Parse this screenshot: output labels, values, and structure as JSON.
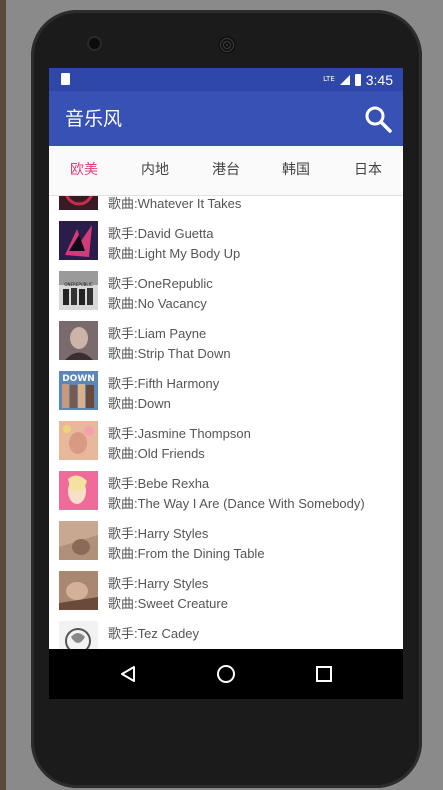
{
  "status_bar": {
    "network_label": "LTE",
    "time": "3:45"
  },
  "app_bar": {
    "title": "音乐风"
  },
  "tabs": [
    {
      "label": "欧美",
      "active": true
    },
    {
      "label": "内地",
      "active": false
    },
    {
      "label": "港台",
      "active": false
    },
    {
      "label": "韩国",
      "active": false
    },
    {
      "label": "日本",
      "active": false
    }
  ],
  "songs": [
    {
      "artist": "",
      "song": "歌曲:Whatever It Takes"
    },
    {
      "artist": "歌手:David Guetta",
      "song": "歌曲:Light My Body Up"
    },
    {
      "artist": "歌手:OneRepublic",
      "song": "歌曲:No Vacancy"
    },
    {
      "artist": "歌手:Liam Payne",
      "song": "歌曲:Strip That Down"
    },
    {
      "artist": "歌手:Fifth Harmony",
      "song": "歌曲:Down"
    },
    {
      "artist": "歌手:Jasmine Thompson",
      "song": "歌曲:Old Friends"
    },
    {
      "artist": "歌手:Bebe Rexha",
      "song": "歌曲:The Way I Are (Dance With Somebody)"
    },
    {
      "artist": "歌手:Harry Styles",
      "song": "歌曲:From the Dining Table"
    },
    {
      "artist": "歌手:Harry Styles",
      "song": "歌曲:Sweet Creature"
    },
    {
      "artist": "歌手:Tez Cadey",
      "song": ""
    }
  ],
  "cover_art_text": {
    "onerepublic": "ONEREPUBLIC",
    "down": "DOWN"
  },
  "colors": {
    "primary_dark": "#2f47a9",
    "primary": "#3751b5",
    "accent": "#e0407a"
  }
}
